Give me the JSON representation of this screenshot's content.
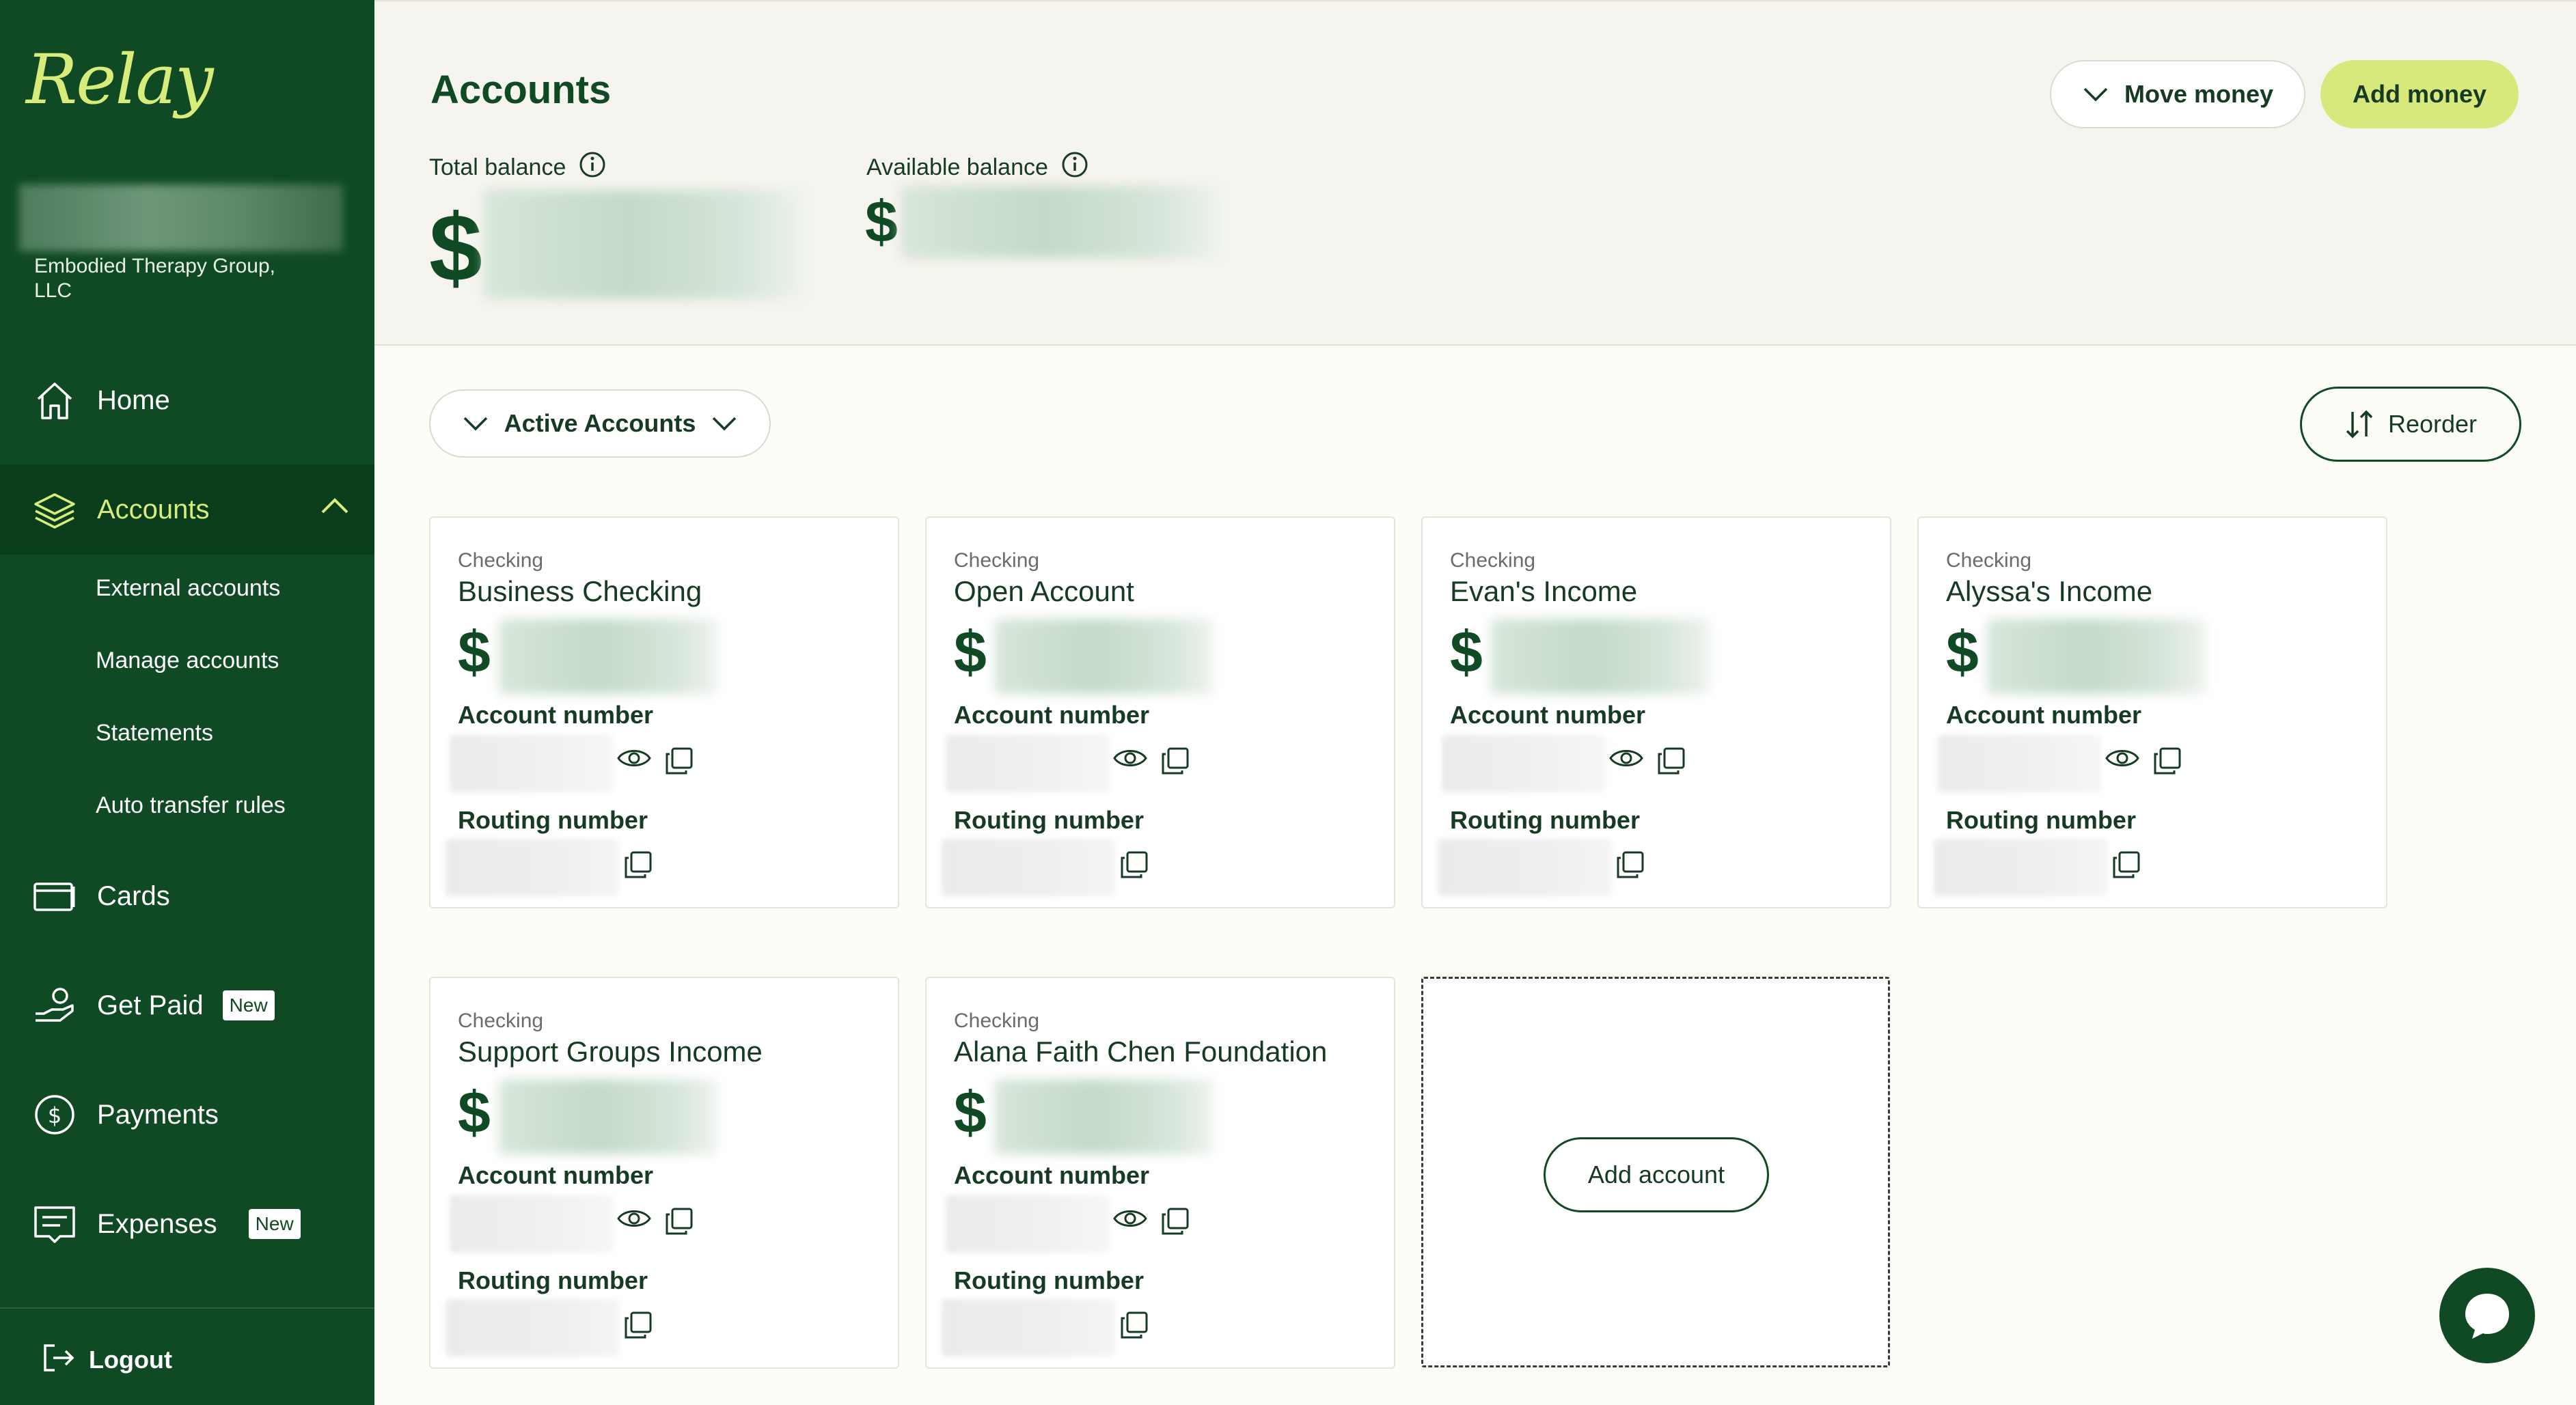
{
  "sidebar": {
    "logo": "Relay",
    "org_name": "Embodied Therapy Group, LLC",
    "nav": {
      "home": "Home",
      "accounts": "Accounts",
      "cards": "Cards",
      "get_paid": "Get Paid",
      "get_paid_badge": "New",
      "payments": "Payments",
      "expenses": "Expenses",
      "expenses_badge": "New"
    },
    "sub_items": [
      "External accounts",
      "Manage accounts",
      "Statements",
      "Auto transfer rules"
    ],
    "logout": "Logout"
  },
  "header": {
    "title": "Accounts",
    "total_balance_label": "Total balance",
    "available_balance_label": "Available balance",
    "currency_symbol": "$",
    "move_money": "Move money",
    "add_money": "Add money"
  },
  "toolbar": {
    "filter_label": "Active Accounts",
    "reorder": "Reorder"
  },
  "cards": [
    {
      "type": "Checking",
      "name": "Business Checking",
      "currency": "$",
      "account_label": "Account number",
      "routing_label": "Routing number"
    },
    {
      "type": "Checking",
      "name": "Open Account",
      "currency": "$",
      "account_label": "Account number",
      "routing_label": "Routing number"
    },
    {
      "type": "Checking",
      "name": "Evan's Income",
      "currency": "$",
      "account_label": "Account number",
      "routing_label": "Routing number"
    },
    {
      "type": "Checking",
      "name": "Alyssa's Income",
      "currency": "$",
      "account_label": "Account number",
      "routing_label": "Routing number"
    },
    {
      "type": "Checking",
      "name": "Support Groups Income",
      "currency": "$",
      "account_label": "Account number",
      "routing_label": "Routing number"
    },
    {
      "type": "Checking",
      "name": "Alana Faith Chen Foundation",
      "currency": "$",
      "account_label": "Account number",
      "routing_label": "Routing number"
    }
  ],
  "add_account": "Add account",
  "colors": {
    "sidebar_bg": "#0f4a24",
    "accent_lime": "#d7e87c",
    "page_bg": "#fdfdf7",
    "header_bg": "#f6f4ee"
  },
  "icons": [
    "home-icon",
    "layers-icon",
    "chevron-up-icon",
    "card-icon",
    "hand-coin-icon",
    "dollar-circle-icon",
    "receipt-icon",
    "logout-icon",
    "info-icon",
    "chevron-down-icon",
    "sort-icon",
    "eye-icon",
    "copy-icon",
    "chat-icon"
  ]
}
